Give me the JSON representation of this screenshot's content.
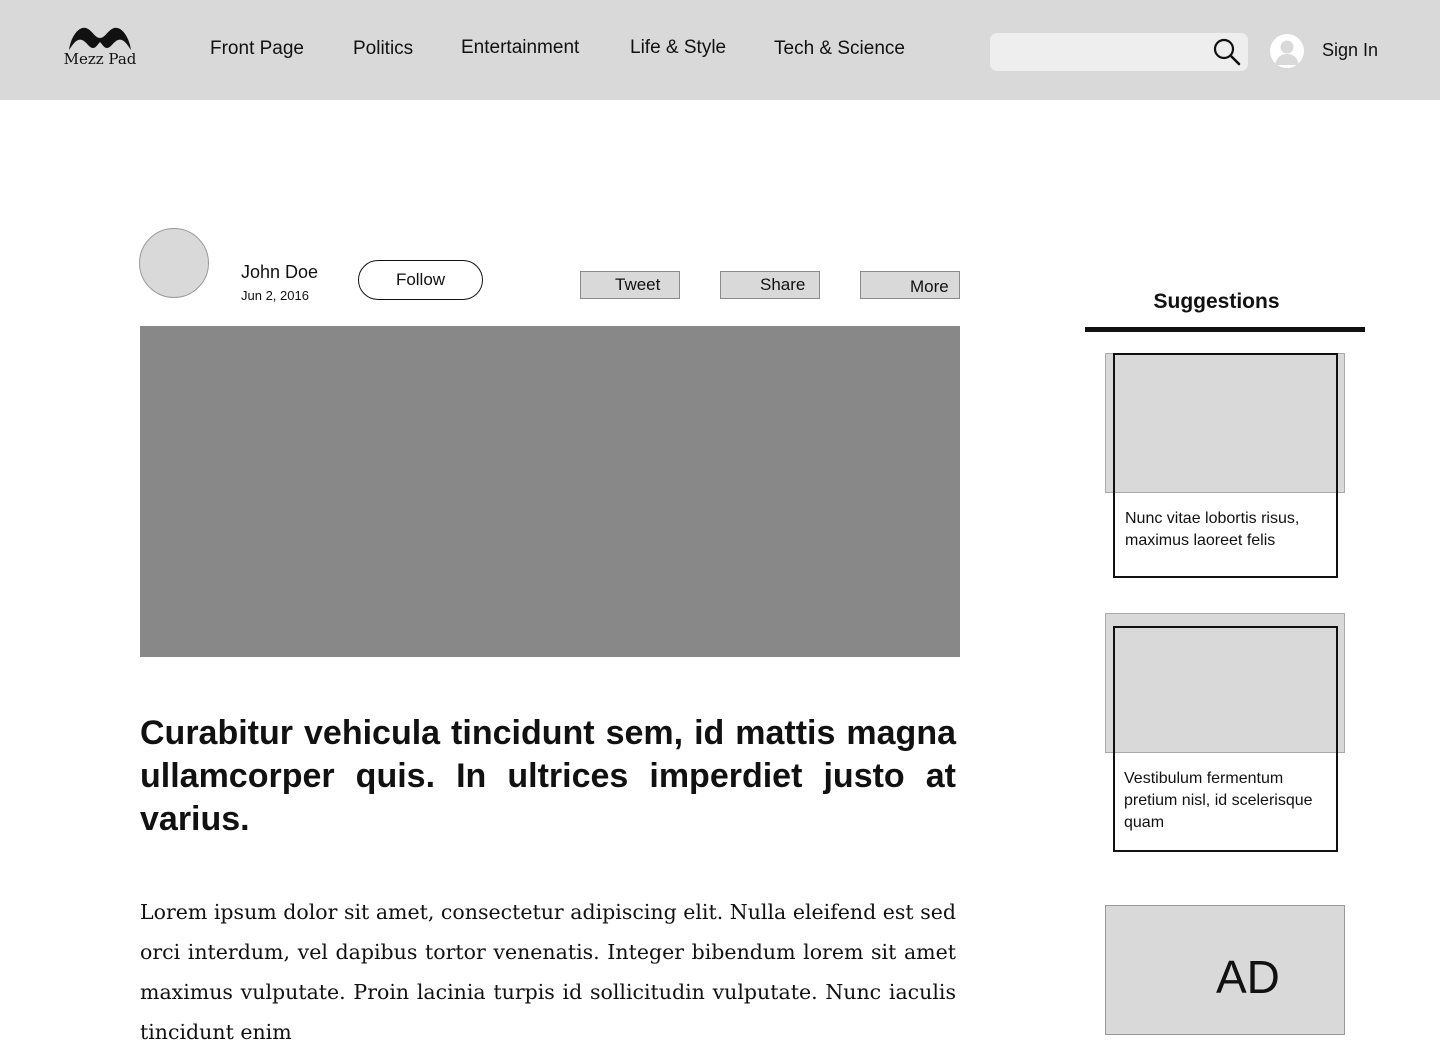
{
  "header": {
    "logo_text": "Mezz Pad",
    "nav": [
      "Front Page",
      "Politics",
      "Entertainment",
      "Life & Style",
      "Tech & Science"
    ],
    "search": {
      "value": "",
      "placeholder": ""
    },
    "sign_in": "Sign In",
    "icons": {
      "search": "search-icon",
      "user": "user-avatar-icon",
      "logo": "mustache-logo-icon"
    }
  },
  "article": {
    "author": "John Doe",
    "date": "Jun 2, 2016",
    "follow": "Follow",
    "actions": [
      "Tweet",
      "Share",
      "More"
    ],
    "headline": "Curabitur vehicula tincidunt sem, id mattis magna ullamcorper quis. In ultrices imperdiet justo at varius.",
    "body": "Lorem ipsum dolor sit amet, consectetur adipiscing elit. Nulla eleifend est sed orci interdum, vel dapibus tortor venenatis. Integer bibendum lorem sit amet maximus vulputate. Proin lacinia turpis id sollicitudin vulputate. Nunc iaculis tincidunt enim"
  },
  "sidebar": {
    "title": "Suggestions",
    "cards": [
      {
        "text": "Nunc vitae lobortis risus, maximus laoreet felis"
      },
      {
        "text": "Vestibulum fermentum pretium nisl, id scelerisque quam"
      }
    ],
    "ad": "AD"
  },
  "colors": {
    "header_bg": "#d9d9d9",
    "hero_bg": "#888888",
    "placeholder": "#d9d9d9",
    "text": "#111111"
  }
}
